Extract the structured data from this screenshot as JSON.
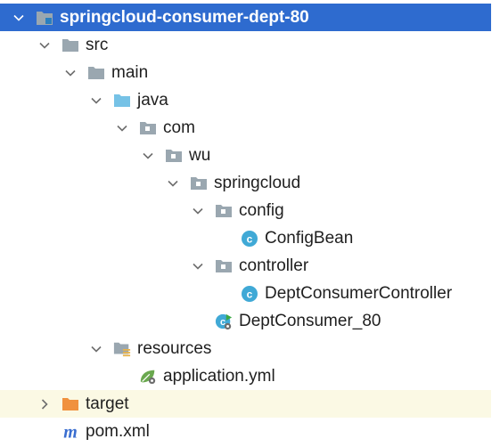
{
  "tree": {
    "rows": [
      {
        "label": "springcloud-consumer-dept-80",
        "icon": "module-folder-icon",
        "expanded": true
      },
      {
        "label": "src",
        "icon": "folder-icon",
        "expanded": true
      },
      {
        "label": "main",
        "icon": "folder-icon",
        "expanded": true
      },
      {
        "label": "java",
        "icon": "source-root-folder-icon",
        "expanded": true
      },
      {
        "label": "com",
        "icon": "package-icon",
        "expanded": true
      },
      {
        "label": "wu",
        "icon": "package-icon",
        "expanded": true
      },
      {
        "label": "springcloud",
        "icon": "package-icon",
        "expanded": true
      },
      {
        "label": "config",
        "icon": "package-icon",
        "expanded": true
      },
      {
        "label": "ConfigBean",
        "icon": "class-icon"
      },
      {
        "label": "controller",
        "icon": "package-icon",
        "expanded": true
      },
      {
        "label": "DeptConsumerController",
        "icon": "class-icon"
      },
      {
        "label": "DeptConsumer_80",
        "icon": "spring-boot-class-icon"
      },
      {
        "label": "resources",
        "icon": "resources-folder-icon",
        "expanded": true
      },
      {
        "label": "application.yml",
        "icon": "spring-config-icon"
      },
      {
        "label": "target",
        "icon": "excluded-folder-icon",
        "expanded": false
      },
      {
        "label": "pom.xml",
        "icon": "maven-icon"
      }
    ]
  },
  "colors": {
    "selection": "#2e6bcf",
    "highlight": "#fbf9e4",
    "folder": "#9aa7b0",
    "source_folder": "#76c2e6",
    "excluded_folder": "#f0913e",
    "class": "#40a9d6",
    "spring": "#6aa84f",
    "maven": "#3a6ed0"
  }
}
